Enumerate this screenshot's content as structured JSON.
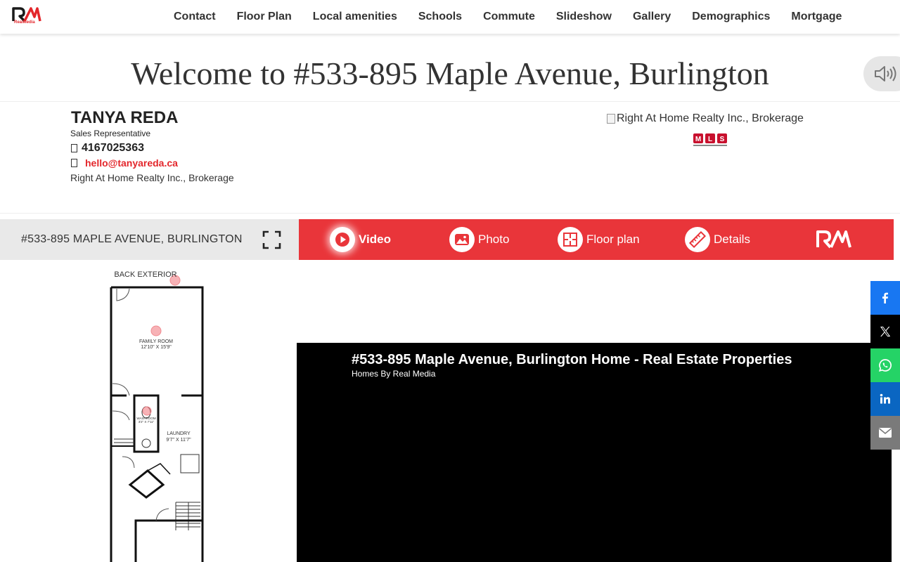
{
  "brand": {
    "logo_sub": "RealMedia",
    "accent": "#e9353a",
    "red_text": "#e3262b"
  },
  "nav": {
    "items": [
      {
        "label": "Contact"
      },
      {
        "label": "Floor Plan"
      },
      {
        "label": "Local amenities"
      },
      {
        "label": "Schools"
      },
      {
        "label": "Commute"
      },
      {
        "label": "Slideshow"
      },
      {
        "label": "Gallery"
      },
      {
        "label": "Demographics"
      },
      {
        "label": "Mortgage"
      }
    ]
  },
  "welcome": {
    "title": "Welcome to #533-895 Maple Avenue, Burlington"
  },
  "agent": {
    "name": "TANYA REDA",
    "title": "Sales Representative",
    "phone": "4167025363",
    "email": "hello@tanyareda.ca",
    "brokerage": "Right At Home Realty Inc., Brokerage"
  },
  "brokerage_image": {
    "alt": "Right At Home Realty Inc., Brokerage"
  },
  "tabs": {
    "address": "#533-895 MAPLE AVENUE, BURLINGTON",
    "items": [
      {
        "label": "Video",
        "icon": "play-icon",
        "active": true
      },
      {
        "label": "Photo",
        "icon": "image-icon",
        "active": false
      },
      {
        "label": "Floor plan",
        "icon": "floorplan-icon",
        "active": false
      },
      {
        "label": "Details",
        "icon": "ruler-icon",
        "active": false
      }
    ]
  },
  "floorplan": {
    "back_exterior": "BACK EXTERIOR",
    "family_room": "FAMILY ROOM",
    "family_room_dim": "12'10\" X 15'9\"",
    "washroom": "WASHROOM",
    "washroom_dim": "3'2\" X 7'11\"",
    "laundry": "LAUNDRY",
    "laundry_dim": "9'7\" X 11'7\""
  },
  "video": {
    "title": "#533-895 Maple Avenue, Burlington Home - Real Estate Properties",
    "subtitle": "Homes By Real Media"
  },
  "share": {
    "facebook_color": "#1877f2",
    "x_color": "#000000",
    "whatsapp_color": "#25d366",
    "linkedin_color": "#0a66c2",
    "email_color": "#7a7a7a"
  }
}
